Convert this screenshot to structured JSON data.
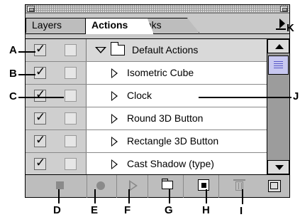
{
  "tabs": [
    {
      "label": "Layers"
    },
    {
      "label": "Actions"
    },
    {
      "label": "Links"
    }
  ],
  "actions": [
    {
      "label": "Default Actions",
      "type": "set",
      "expanded": true,
      "enabled": true
    },
    {
      "label": "Isometric Cube",
      "type": "action",
      "enabled": true
    },
    {
      "label": "Clock",
      "type": "action",
      "enabled": true
    },
    {
      "label": "Round 3D Button",
      "type": "action",
      "enabled": true
    },
    {
      "label": "Rectangle 3D Button",
      "type": "action",
      "enabled": true
    },
    {
      "label": "Cast Shadow (type)",
      "type": "action",
      "enabled": true
    }
  ],
  "footer_buttons": [
    {
      "icon": "stop-icon",
      "enabled": false
    },
    {
      "icon": "record-icon",
      "enabled": false
    },
    {
      "icon": "play-icon",
      "enabled": false
    },
    {
      "icon": "new-set-icon",
      "enabled": true
    },
    {
      "icon": "new-action-icon",
      "enabled": true
    },
    {
      "icon": "trash-icon",
      "enabled": false
    }
  ],
  "callouts": {
    "a": "A",
    "b": "B",
    "c": "C",
    "d": "D",
    "e": "E",
    "f": "F",
    "g": "G",
    "h": "H",
    "i": "I",
    "j": "J",
    "k": "K"
  },
  "colors": {
    "panel": "#c9c9c9",
    "list": "#ffffff",
    "scroll_thumb": "#c8c8f0"
  }
}
